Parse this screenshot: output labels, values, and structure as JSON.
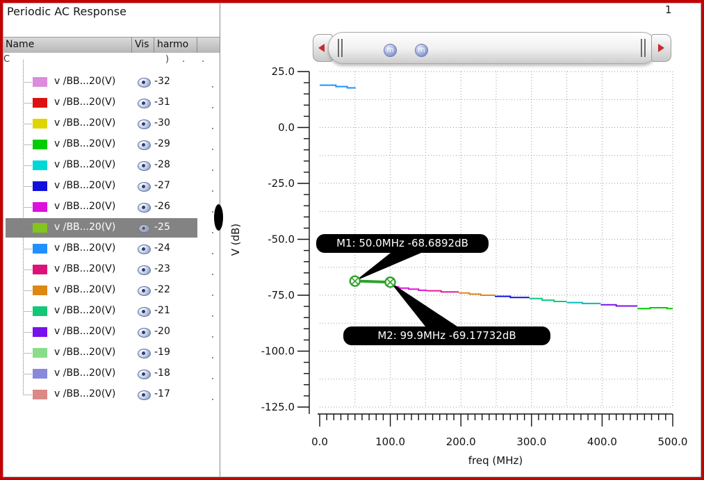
{
  "window": {
    "title": "Periodic AC Response",
    "page_number": "1"
  },
  "table": {
    "columns": [
      "Name",
      "Vis",
      "harmo"
    ],
    "row_label": "v /BB...20(V)",
    "clipped_row_fragments": [
      "C",
      ")",
      ".",
      "."
    ],
    "rows": [
      {
        "color": "#DC8CDC",
        "harmonic": "-32",
        "eye": "open",
        "selected": false
      },
      {
        "color": "#DD1111",
        "harmonic": "-31",
        "eye": "open",
        "selected": false
      },
      {
        "color": "#DDD600",
        "harmonic": "-30",
        "eye": "open",
        "selected": false
      },
      {
        "color": "#00CC00",
        "harmonic": "-29",
        "eye": "open",
        "selected": false
      },
      {
        "color": "#00D8D8",
        "harmonic": "-28",
        "eye": "open",
        "selected": false
      },
      {
        "color": "#1111DD",
        "harmonic": "-27",
        "eye": "open",
        "selected": false
      },
      {
        "color": "#DD11DD",
        "harmonic": "-26",
        "eye": "open",
        "selected": false
      },
      {
        "color": "#84C41E",
        "harmonic": "-25",
        "eye": "dim",
        "selected": true
      },
      {
        "color": "#1E90FF",
        "harmonic": "-24",
        "eye": "open",
        "selected": false
      },
      {
        "color": "#DD1177",
        "harmonic": "-23",
        "eye": "open",
        "selected": false
      },
      {
        "color": "#DD8811",
        "harmonic": "-22",
        "eye": "open",
        "selected": false
      },
      {
        "color": "#10C878",
        "harmonic": "-21",
        "eye": "open",
        "selected": false
      },
      {
        "color": "#7711EE",
        "harmonic": "-20",
        "eye": "open",
        "selected": false
      },
      {
        "color": "#88DD88",
        "harmonic": "-19",
        "eye": "open",
        "selected": false
      },
      {
        "color": "#8888DD",
        "harmonic": "-18",
        "eye": "open",
        "selected": false
      },
      {
        "color": "#DD8888",
        "harmonic": "-17",
        "eye": "open",
        "selected": false
      }
    ]
  },
  "scrollbar": {
    "badges": [
      "m",
      "m"
    ]
  },
  "chart_data": {
    "type": "line",
    "xlabel": "freq (MHz)",
    "ylabel": "V (dB)",
    "xlim": [
      0,
      500
    ],
    "ylim": [
      -125,
      25
    ],
    "xticks": [
      "0.0",
      "100.0",
      "200.0",
      "300.0",
      "400.0",
      "500.0"
    ],
    "yticks": [
      "25.0",
      "0.0",
      "-25.0",
      "-50.0",
      "-75.0",
      "-100.0",
      "-125.0"
    ],
    "grid": {
      "x_step_mhz": 50,
      "y_step_db": 12.5,
      "style": "dotted"
    },
    "x_minor_mhz": 10,
    "y_minor_db": 5,
    "x_major_mhz": 100,
    "y_major_db": 25,
    "series": [
      {
        "color": "#1E90FF",
        "width": 2,
        "points": [
          [
            0,
            18.9
          ],
          [
            23,
            18.9
          ],
          [
            23,
            18.3
          ],
          [
            39,
            18.3
          ],
          [
            39,
            17.7
          ],
          [
            51,
            17.7
          ]
        ]
      },
      {
        "color": "#2EA12E",
        "width": 4,
        "selected": true,
        "points": [
          [
            48,
            -68.6
          ],
          [
            100,
            -69.2
          ]
        ]
      },
      {
        "color": "#DD11DD",
        "width": 2,
        "points": [
          [
            100,
            -70.9
          ],
          [
            112,
            -71.3
          ],
          [
            112,
            -71.8
          ],
          [
            126,
            -71.8
          ],
          [
            126,
            -72.3
          ],
          [
            140,
            -72.3
          ],
          [
            140,
            -72.8
          ],
          [
            152,
            -72.8
          ]
        ]
      },
      {
        "color": "#E8189B",
        "width": 2,
        "points": [
          [
            152,
            -73.0
          ],
          [
            172,
            -73.0
          ],
          [
            172,
            -73.5
          ],
          [
            197,
            -73.5
          ]
        ]
      },
      {
        "color": "#DD8811",
        "width": 2,
        "points": [
          [
            197,
            -74.0
          ],
          [
            212,
            -74.0
          ],
          [
            212,
            -74.5
          ],
          [
            228,
            -74.5
          ],
          [
            228,
            -75.0
          ],
          [
            248,
            -75.0
          ]
        ]
      },
      {
        "color": "#1111DD",
        "width": 2,
        "points": [
          [
            248,
            -75.5
          ],
          [
            270,
            -75.5
          ],
          [
            270,
            -76.0
          ],
          [
            297,
            -76.0
          ]
        ]
      },
      {
        "color": "#10C878",
        "width": 2,
        "points": [
          [
            297,
            -76.5
          ],
          [
            315,
            -76.5
          ],
          [
            315,
            -77.2
          ],
          [
            332,
            -77.2
          ],
          [
            332,
            -77.8
          ],
          [
            350,
            -77.8
          ]
        ]
      },
      {
        "color": "#00BBBB",
        "width": 2,
        "points": [
          [
            350,
            -78.3
          ],
          [
            372,
            -78.3
          ],
          [
            372,
            -78.7
          ],
          [
            398,
            -78.7
          ]
        ]
      },
      {
        "color": "#7711EE",
        "width": 2,
        "points": [
          [
            398,
            -79.3
          ],
          [
            420,
            -79.3
          ],
          [
            420,
            -79.8
          ],
          [
            450,
            -79.8
          ]
        ]
      },
      {
        "color": "#00CC00",
        "width": 2,
        "points": [
          [
            450,
            -81.0
          ],
          [
            468,
            -81.0
          ],
          [
            468,
            -80.6
          ],
          [
            492,
            -80.6
          ],
          [
            492,
            -81.0
          ],
          [
            500,
            -81.0
          ]
        ]
      }
    ],
    "markers": [
      {
        "id": "M1",
        "text": "M1: 50.0MHz -68.6892dB",
        "freq_mhz": 50.0,
        "value_db": -68.6892
      },
      {
        "id": "M2",
        "text": "M2: 99.9MHz -69.17732dB",
        "freq_mhz": 99.9,
        "value_db": -69.17732
      }
    ]
  }
}
